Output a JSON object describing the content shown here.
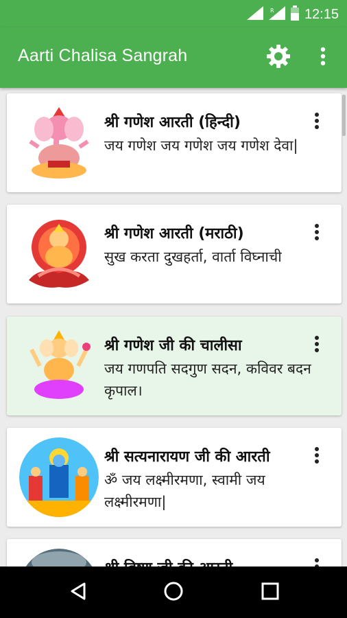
{
  "status_bar": {
    "time": "12:15",
    "icons": [
      "wifi-icon",
      "signal-icon",
      "battery-icon"
    ]
  },
  "app_bar": {
    "title": "Aarti Chalisa Sangrah",
    "icons": [
      "settings-icon",
      "more-vert-icon"
    ]
  },
  "colors": {
    "primary": "#4caf50",
    "selected_card": "#e8f5e9",
    "background": "#ececec"
  },
  "items": [
    {
      "title": "श्री गणेश आरती (हिन्दी)",
      "text": "जय गणेश जय गणेश जय गणेश देवा|",
      "image": "ganesh-idol-image"
    },
    {
      "title": "श्री गणेश आरती (मराठी)",
      "text": "सुख करता दुखहर्ता, वार्ता विघ्नाची",
      "image": "ganesh-lotus-image"
    },
    {
      "title": "श्री गणेश जी की चालीसा",
      "text": "जय गणपति सदगुण सदन, कविवर बदन कृपाल।",
      "image": "ganesh-seated-image"
    },
    {
      "title": "श्री सत्यनारायण जी की आरती",
      "text": "ॐ जय लक्ष्मीरमणा, स्वामी जय लक्ष्मीरमणा|",
      "image": "satyanarayan-image"
    },
    {
      "title": "श्री विष्णु जी की आरती",
      "text": "",
      "image": "vishnu-image"
    }
  ],
  "nav_bar": {
    "icons": [
      "back-icon",
      "home-icon",
      "recents-icon"
    ]
  }
}
